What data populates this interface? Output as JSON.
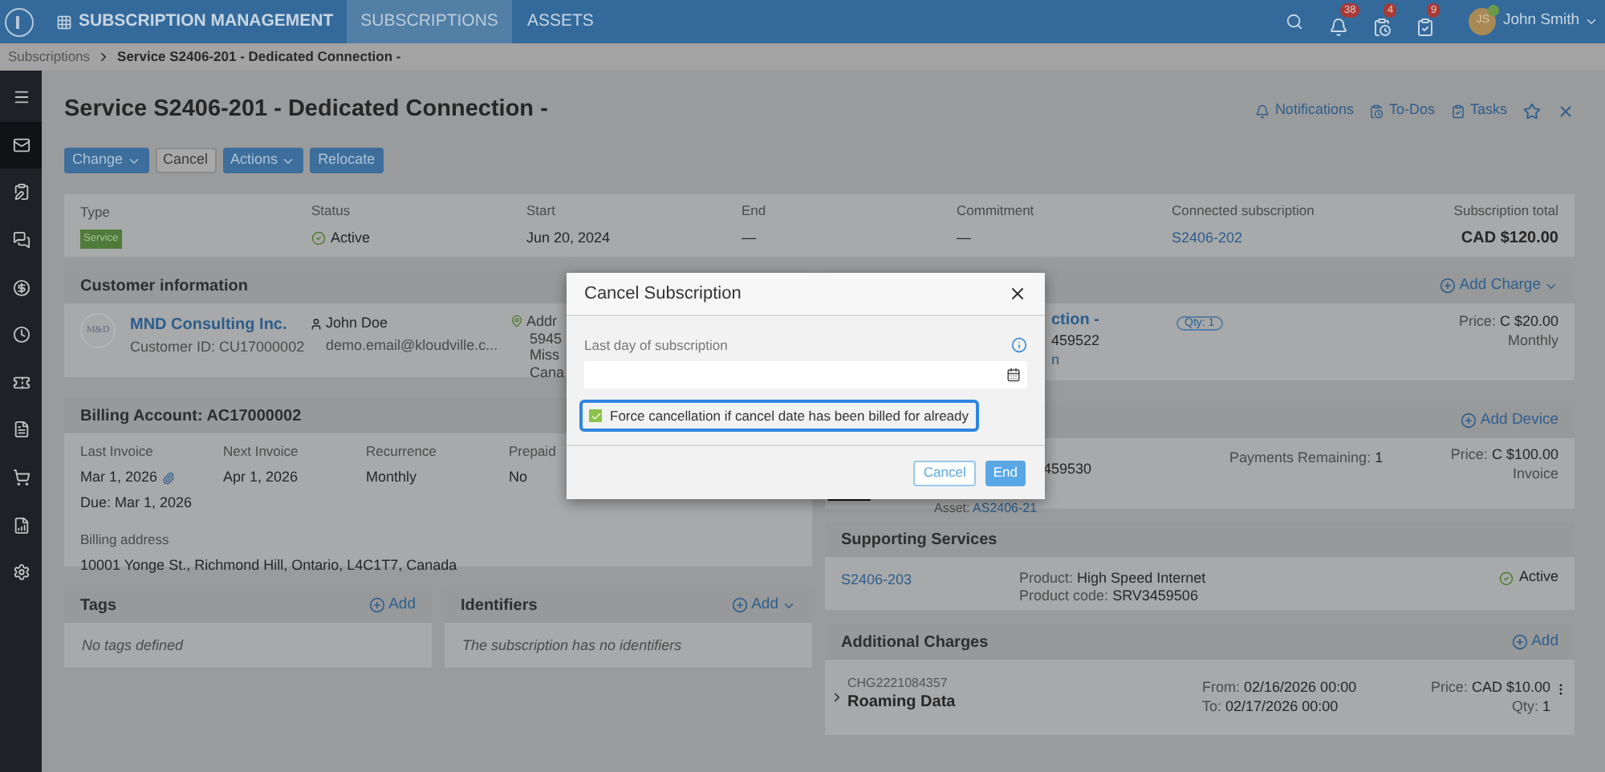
{
  "top_bar": {
    "module": "SUBSCRIPTION MANAGEMENT",
    "tabs": [
      {
        "label": "SUBSCRIPTIONS",
        "selected": true
      },
      {
        "label": "ASSETS",
        "selected": false
      }
    ],
    "alerts": [
      {
        "kind": "bell",
        "count": "38"
      },
      {
        "kind": "todo",
        "count": "4"
      },
      {
        "kind": "task",
        "count": "9"
      }
    ],
    "user": {
      "initials": "JS",
      "name": "John Smith"
    }
  },
  "breadcrumb": [
    "Subscriptions",
    "Service S2406-201 - Dedicated Connection -"
  ],
  "sidebar": [
    {
      "kind": "menu",
      "selected": false
    },
    {
      "kind": "mail",
      "selected": true
    },
    {
      "kind": "clipboard",
      "selected": false
    },
    {
      "kind": "chat",
      "selected": false
    },
    {
      "kind": "dollar",
      "selected": false
    },
    {
      "kind": "clock",
      "selected": false
    },
    {
      "kind": "ticket",
      "selected": false
    },
    {
      "kind": "invoice",
      "selected": false
    },
    {
      "kind": "cart",
      "selected": false
    },
    {
      "kind": "document",
      "selected": false
    },
    {
      "kind": "settings",
      "selected": false
    }
  ],
  "page": {
    "title": "Service S2406-201 - Dedicated Connection -",
    "links": [
      {
        "kind": "bell",
        "label": "Notifications"
      },
      {
        "kind": "todo",
        "label": "To-Dos"
      },
      {
        "kind": "task",
        "label": "Tasks"
      }
    ],
    "buttons": [
      {
        "label": "Change",
        "kind": "dropdown"
      },
      {
        "label": "Cancel",
        "kind": "plain"
      },
      {
        "label": "Actions",
        "kind": "dropdown"
      },
      {
        "label": "Relocate",
        "kind": "primary"
      }
    ]
  },
  "summary": [
    {
      "label": "Type",
      "value": "Service",
      "kind": "tag"
    },
    {
      "label": "Status",
      "value": "Active",
      "kind": "status"
    },
    {
      "label": "Start",
      "value": "Jun 20, 2024",
      "kind": "text"
    },
    {
      "label": "End",
      "value": "—",
      "kind": "text"
    },
    {
      "label": "Commitment",
      "value": "—",
      "kind": "text"
    },
    {
      "label": "Connected subscription",
      "value": "S2406-202",
      "kind": "link"
    },
    {
      "label": "Subscription total",
      "value": "CAD $120.00",
      "kind": "total"
    }
  ],
  "customer": {
    "title": "Customer information",
    "logo": "M&D",
    "name": "MND Consulting Inc.",
    "id_label": "Customer ID:",
    "id": "CU17000002",
    "contact": "John Doe",
    "email": "demo.email@kloudville.c...",
    "address": [
      "Addr",
      "5945",
      "Miss",
      "Cana"
    ]
  },
  "billing": {
    "title": "Billing Account: AC17000002",
    "fields": [
      {
        "label": "Last Invoice",
        "values": [
          "Mar 1, 2026",
          "Due: Mar 1, 2026"
        ],
        "attachment": true
      },
      {
        "label": "Next Invoice",
        "values": [
          "Apr 1, 2026"
        ],
        "attachment": false
      },
      {
        "label": "Recurrence",
        "values": [
          "Monthly"
        ],
        "attachment": false
      },
      {
        "label": "Prepaid",
        "values": [
          "No"
        ],
        "attachment": false
      }
    ],
    "address_label": "Billing address",
    "address": "10001 Yonge St., Richmond Hill, Ontario, L4C1T7, Canada"
  },
  "tags": {
    "title": "Tags",
    "add": "Add",
    "empty": "No tags defined"
  },
  "identifiers": {
    "title": "Identifiers",
    "add": "Add",
    "empty": "The subscription has no identifiers"
  },
  "charge_panel": {
    "add": "Add Charge",
    "name": "ction -",
    "code": "459522",
    "link": "n",
    "qty": "Qty: 1",
    "price_label": "Price:",
    "price": "C $20.00",
    "period": "Monthly"
  },
  "device_panel": {
    "add": "Add Device",
    "code": "459530",
    "asset_label": "Asset:",
    "asset": "AS2406-21",
    "payments_label": "Payments Remaining:",
    "payments": "1",
    "price_label": "Price:",
    "price": "C $100.00",
    "period": "Invoice"
  },
  "supporting": {
    "title": "Supporting Services",
    "id": "S2406-203",
    "product_label": "Product:",
    "product": "High Speed Internet",
    "code_label": "Product code:",
    "code": "SRV3459506",
    "status": "Active"
  },
  "additional": {
    "title": "Additional Charges",
    "add": "Add",
    "items": [
      {
        "code": "CHG2221084357",
        "name": "Roaming Data",
        "from_label": "From:",
        "from": "02/16/2026 00:00",
        "to_label": "To:",
        "to": "02/17/2026 00:00",
        "price_label": "Price:",
        "price": "CAD $10.00",
        "qty_label": "Qty:",
        "qty": "1"
      }
    ]
  },
  "modal": {
    "title": "Cancel Subscription",
    "field_label": "Last day of subscription",
    "force": {
      "label": "Force cancellation if cancel date has been billed for already",
      "checked": true,
      "focused": true
    },
    "buttons": [
      {
        "label": "Cancel",
        "kind": "outline"
      },
      {
        "label": "End",
        "kind": "primary"
      }
    ]
  }
}
